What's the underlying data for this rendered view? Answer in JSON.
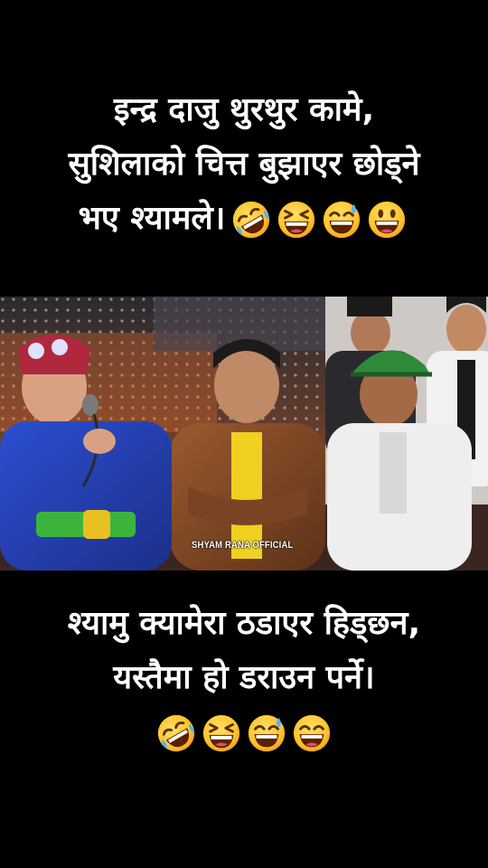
{
  "top_caption": {
    "line1": "इन्द्र दाजु थुरथुर कामे,",
    "line2": "सुशिलाको चित्त बुझाएर छोड्ने",
    "line3": "भए श्यामले।",
    "emojis": [
      "rolling-on-floor-laughing",
      "grinning-squinting",
      "grinning-sweat",
      "grinning-big-eyes"
    ]
  },
  "video": {
    "watermark": "SHYAM RANA OFFICIAL"
  },
  "bottom_caption": {
    "line1": "श्यामु क्यामेरा ठडाएर हिड्छन,",
    "line2": "यस्तैमा हो डराउन पर्ने।",
    "emojis": [
      "rolling-on-floor-laughing",
      "grinning-squinting",
      "grinning-sweat",
      "grinning-smiling-eyes"
    ]
  },
  "colors": {
    "background": "#000000",
    "text": "#ffffff",
    "emoji_face": "#ffcc33"
  }
}
